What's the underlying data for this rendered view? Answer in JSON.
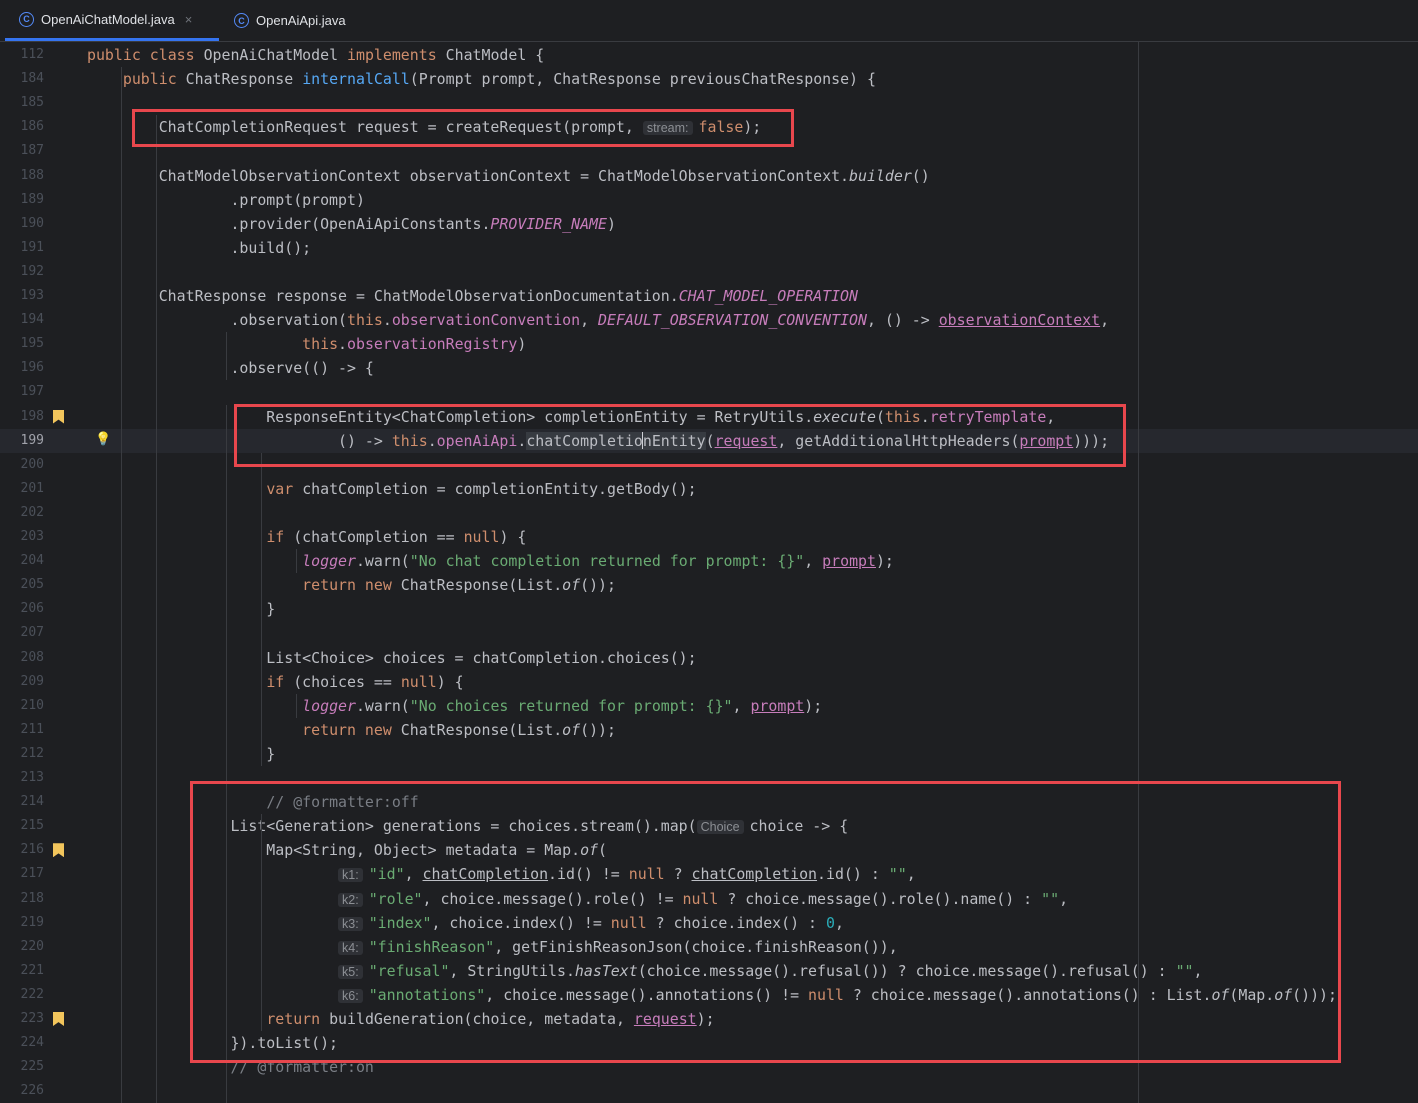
{
  "tabs": [
    {
      "label": "OpenAiChatModel.java",
      "active": true,
      "icon": "class-icon",
      "close": "×"
    },
    {
      "label": "OpenAiApi.java",
      "active": false,
      "icon": "class-icon"
    }
  ],
  "colors": {
    "keyword": "#cf8e6d",
    "method_decl": "#56a8f5",
    "field": "#c77dbb",
    "string": "#6aab73",
    "number": "#2aacb8",
    "comment": "#7a7e85",
    "text": "#bcbec4",
    "highlight_box": "#e8474d",
    "bookmark": "#f2c55c"
  },
  "current_line": 199,
  "lines": [
    {
      "num": "112",
      "tokens": [
        [
          "kw",
          "public "
        ],
        [
          "kw",
          "class "
        ],
        [
          "",
          "OpenAiChatModel "
        ],
        [
          "kw",
          "implements "
        ],
        [
          "",
          "ChatModel {"
        ]
      ]
    },
    {
      "num": "184",
      "tokens": [
        [
          "",
          "    "
        ],
        [
          "kw",
          "public "
        ],
        [
          "",
          "ChatResponse "
        ],
        [
          "fn",
          "internalCall"
        ],
        [
          "",
          "(Prompt prompt, ChatResponse previousChatResponse) {"
        ]
      ]
    },
    {
      "num": "185",
      "tokens": []
    },
    {
      "num": "186",
      "tokens": [
        [
          "",
          "        ChatCompletionRequest request = createRequest(prompt, "
        ],
        [
          "hint",
          "stream:"
        ],
        [
          "kw",
          "false"
        ],
        [
          "",
          ");"
        ]
      ]
    },
    {
      "num": "187",
      "tokens": []
    },
    {
      "num": "188",
      "tokens": [
        [
          "",
          "        ChatModelObservationContext observationContext = ChatModelObservationContext."
        ],
        [
          "it",
          "builder"
        ],
        [
          "",
          "()"
        ]
      ]
    },
    {
      "num": "189",
      "tokens": [
        [
          "",
          "                .prompt(prompt)"
        ]
      ]
    },
    {
      "num": "190",
      "tokens": [
        [
          "",
          "                .provider(OpenAiApiConstants."
        ],
        [
          "static",
          "PROVIDER_NAME"
        ],
        [
          "",
          ")"
        ]
      ]
    },
    {
      "num": "191",
      "tokens": [
        [
          "",
          "                .build();"
        ]
      ]
    },
    {
      "num": "192",
      "tokens": []
    },
    {
      "num": "193",
      "tokens": [
        [
          "",
          "        ChatResponse response = ChatModelObservationDocumentation."
        ],
        [
          "static",
          "CHAT_MODEL_OPERATION"
        ]
      ]
    },
    {
      "num": "194",
      "tokens": [
        [
          "",
          "                .observation("
        ],
        [
          "kw",
          "this"
        ],
        [
          "",
          "."
        ],
        [
          "field",
          "observationConvention"
        ],
        [
          "",
          ", "
        ],
        [
          "static",
          "DEFAULT_OBSERVATION_CONVENTION"
        ],
        [
          "",
          ", () -> "
        ],
        [
          "fieldu",
          "observationContext"
        ],
        [
          "",
          ","
        ]
      ]
    },
    {
      "num": "195",
      "tokens": [
        [
          "",
          "                        "
        ],
        [
          "kw",
          "this"
        ],
        [
          "",
          "."
        ],
        [
          "field",
          "observationRegistry"
        ],
        [
          "",
          ")"
        ]
      ]
    },
    {
      "num": "196",
      "tokens": [
        [
          "",
          "                .observe(() -> {"
        ]
      ]
    },
    {
      "num": "197",
      "tokens": []
    },
    {
      "num": "198",
      "tokens": [
        [
          "",
          "                    ResponseEntity<ChatCompletion> completionEntity = RetryUtils."
        ],
        [
          "it",
          "execute"
        ],
        [
          "",
          "("
        ],
        [
          "kw",
          "this"
        ],
        [
          "",
          "."
        ],
        [
          "field",
          "retryTemplate"
        ],
        [
          "",
          ","
        ]
      ]
    },
    {
      "num": "199",
      "tokens": [
        [
          "",
          "                            () -> "
        ],
        [
          "kw",
          "this"
        ],
        [
          "",
          "."
        ],
        [
          "field",
          "openAiApi"
        ],
        [
          "",
          "."
        ],
        [
          "hl",
          "chatCompletio"
        ],
        [
          "caret",
          ""
        ],
        [
          "hl",
          "nEntity"
        ],
        [
          "",
          "("
        ],
        [
          "uparam",
          "request"
        ],
        [
          "",
          ", getAdditionalHttpHeaders("
        ],
        [
          "uparam",
          "prompt"
        ],
        [
          "",
          ")));"
        ]
      ]
    },
    {
      "num": "200",
      "tokens": []
    },
    {
      "num": "201",
      "tokens": [
        [
          "",
          "                    "
        ],
        [
          "kw",
          "var "
        ],
        [
          "",
          "chatCompletion = completionEntity.getBody();"
        ]
      ]
    },
    {
      "num": "202",
      "tokens": []
    },
    {
      "num": "203",
      "tokens": [
        [
          "",
          "                    "
        ],
        [
          "kw",
          "if "
        ],
        [
          "",
          "(chatCompletion == "
        ],
        [
          "kw",
          "null"
        ],
        [
          "",
          ") {"
        ]
      ]
    },
    {
      "num": "204",
      "tokens": [
        [
          "",
          "                        "
        ],
        [
          "static",
          "logger"
        ],
        [
          "",
          ".warn("
        ],
        [
          "str",
          "\"No chat completion returned for prompt: {}\""
        ],
        [
          "",
          ", "
        ],
        [
          "uparam",
          "prompt"
        ],
        [
          "",
          ");"
        ]
      ]
    },
    {
      "num": "205",
      "tokens": [
        [
          "",
          "                        "
        ],
        [
          "kw",
          "return new "
        ],
        [
          "",
          "ChatResponse(List."
        ],
        [
          "it",
          "of"
        ],
        [
          "",
          "());"
        ]
      ]
    },
    {
      "num": "206",
      "tokens": [
        [
          "",
          "                    }"
        ]
      ]
    },
    {
      "num": "207",
      "tokens": []
    },
    {
      "num": "208",
      "tokens": [
        [
          "",
          "                    List<Choice> choices = chatCompletion.choices();"
        ]
      ]
    },
    {
      "num": "209",
      "tokens": [
        [
          "",
          "                    "
        ],
        [
          "kw",
          "if "
        ],
        [
          "",
          "(choices == "
        ],
        [
          "kw",
          "null"
        ],
        [
          "",
          ") {"
        ]
      ]
    },
    {
      "num": "210",
      "tokens": [
        [
          "",
          "                        "
        ],
        [
          "static",
          "logger"
        ],
        [
          "",
          ".warn("
        ],
        [
          "str",
          "\"No choices returned for prompt: {}\""
        ],
        [
          "",
          ", "
        ],
        [
          "uparam",
          "prompt"
        ],
        [
          "",
          ");"
        ]
      ]
    },
    {
      "num": "211",
      "tokens": [
        [
          "",
          "                        "
        ],
        [
          "kw",
          "return new "
        ],
        [
          "",
          "ChatResponse(List."
        ],
        [
          "it",
          "of"
        ],
        [
          "",
          "());"
        ]
      ]
    },
    {
      "num": "212",
      "tokens": [
        [
          "",
          "                    }"
        ]
      ]
    },
    {
      "num": "213",
      "tokens": []
    },
    {
      "num": "214",
      "tokens": [
        [
          "",
          "                    "
        ],
        [
          "cm",
          "// @formatter:off"
        ]
      ]
    },
    {
      "num": "215",
      "tokens": [
        [
          "",
          "                List<Generation> generations = choices.stream().map("
        ],
        [
          "hint",
          "Choice"
        ],
        [
          "",
          "choice -> {"
        ]
      ]
    },
    {
      "num": "216",
      "tokens": [
        [
          "",
          "                    Map<String, Object> metadata = Map."
        ],
        [
          "it",
          "of"
        ],
        [
          "",
          "("
        ]
      ]
    },
    {
      "num": "217",
      "tokens": [
        [
          "",
          "                            "
        ],
        [
          "hint",
          "k1:"
        ],
        [
          "str",
          "\"id\""
        ],
        [
          "",
          ", "
        ],
        [
          "u",
          "chatCompletion"
        ],
        [
          "",
          ".id() != "
        ],
        [
          "kw",
          "null"
        ],
        [
          "",
          " ? "
        ],
        [
          "u",
          "chatCompletion"
        ],
        [
          "",
          ".id() : "
        ],
        [
          "str",
          "\"\""
        ],
        [
          "",
          ","
        ]
      ]
    },
    {
      "num": "218",
      "tokens": [
        [
          "",
          "                            "
        ],
        [
          "hint",
          "k2:"
        ],
        [
          "str",
          "\"role\""
        ],
        [
          "",
          ", choice.message().role() != "
        ],
        [
          "kw",
          "null"
        ],
        [
          "",
          " ? choice.message().role().name() : "
        ],
        [
          "str",
          "\"\""
        ],
        [
          "",
          ","
        ]
      ]
    },
    {
      "num": "219",
      "tokens": [
        [
          "",
          "                            "
        ],
        [
          "hint",
          "k3:"
        ],
        [
          "str",
          "\"index\""
        ],
        [
          "",
          ", choice.index() != "
        ],
        [
          "kw",
          "null"
        ],
        [
          "",
          " ? choice.index() : "
        ],
        [
          "num",
          "0"
        ],
        [
          "",
          ","
        ]
      ]
    },
    {
      "num": "220",
      "tokens": [
        [
          "",
          "                            "
        ],
        [
          "hint",
          "k4:"
        ],
        [
          "str",
          "\"finishReason\""
        ],
        [
          "",
          ", getFinishReasonJson(choice.finishReason()),"
        ]
      ]
    },
    {
      "num": "221",
      "tokens": [
        [
          "",
          "                            "
        ],
        [
          "hint",
          "k5:"
        ],
        [
          "str",
          "\"refusal\""
        ],
        [
          "",
          ", StringUtils."
        ],
        [
          "it",
          "hasText"
        ],
        [
          "",
          "(choice.message().refusal()) ? choice.message().refusal() : "
        ],
        [
          "str",
          "\"\""
        ],
        [
          "",
          ","
        ]
      ]
    },
    {
      "num": "222",
      "tokens": [
        [
          "",
          "                            "
        ],
        [
          "hint",
          "k6:"
        ],
        [
          "str",
          "\"annotations\""
        ],
        [
          "",
          ", choice.message().annotations() != "
        ],
        [
          "kw",
          "null"
        ],
        [
          "",
          " ? choice.message().annotations() : List."
        ],
        [
          "it",
          "of"
        ],
        [
          "",
          "(Map."
        ],
        [
          "it",
          "of"
        ],
        [
          "",
          "()));"
        ]
      ]
    },
    {
      "num": "223",
      "tokens": [
        [
          "",
          "                    "
        ],
        [
          "kw",
          "return "
        ],
        [
          "",
          "buildGeneration(choice, metadata, "
        ],
        [
          "uparam",
          "request"
        ],
        [
          "",
          ");"
        ]
      ]
    },
    {
      "num": "224",
      "tokens": [
        [
          "",
          "                }).toList();"
        ]
      ]
    },
    {
      "num": "225",
      "tokens": [
        [
          "",
          "                "
        ],
        [
          "cm",
          "// @formatter:on"
        ]
      ]
    },
    {
      "num": "226",
      "tokens": []
    }
  ],
  "bookmarks": [
    "198",
    "216",
    "223"
  ],
  "intention_bulb_line": "199"
}
